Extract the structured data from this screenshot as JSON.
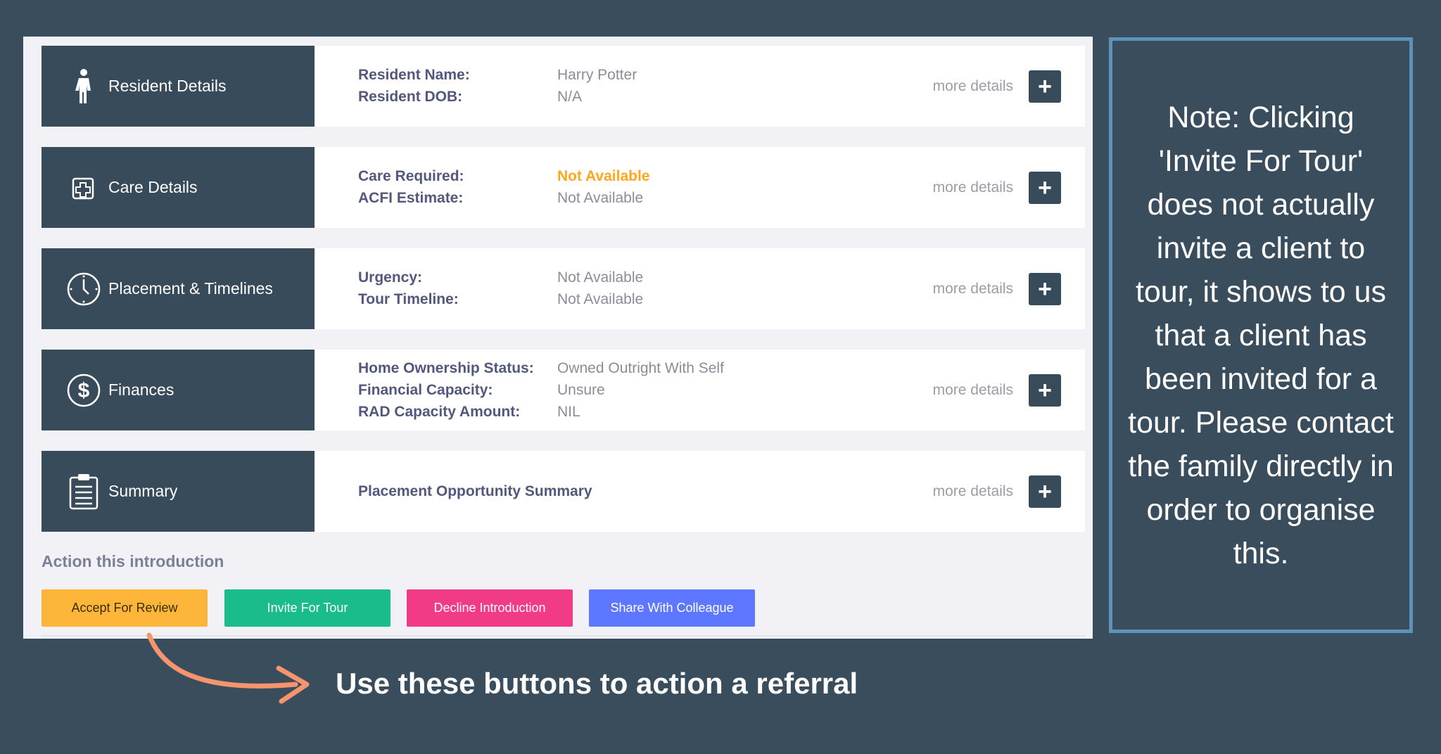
{
  "cards": [
    {
      "title": "Resident Details",
      "icon": "person-icon",
      "rows": [
        {
          "label": "Resident Name:",
          "value": "Harry Potter"
        },
        {
          "label": "Resident DOB:",
          "value": "N/A"
        }
      ],
      "more": "more details"
    },
    {
      "title": "Care Details",
      "icon": "medical-cross-icon",
      "rows": [
        {
          "label": "Care Required:",
          "value": "Not Available"
        },
        {
          "label": "ACFI Estimate:",
          "value": "Not Available"
        }
      ],
      "more": "more details"
    },
    {
      "title": "Placement & Timelines",
      "icon": "clock-icon",
      "rows": [
        {
          "label": "Urgency:",
          "value": "Not Available"
        },
        {
          "label": "Tour Timeline:",
          "value": "Not Available"
        }
      ],
      "more": "more details"
    },
    {
      "title": "Finances",
      "icon": "dollar-icon",
      "rows": [
        {
          "label": "Home Ownership Status:",
          "value": "Owned Outright With Self"
        },
        {
          "label": "Financial Capacity:",
          "value": "Unsure"
        },
        {
          "label": "RAD Capacity Amount:",
          "value": "NIL"
        }
      ],
      "more": "more details"
    },
    {
      "title": "Summary",
      "icon": "clipboard-icon",
      "summary_label": "Placement Opportunity Summary",
      "more": "more details"
    }
  ],
  "actions": {
    "heading": "Action this introduction",
    "accept": "Accept For Review",
    "invite": "Invite For Tour",
    "decline": "Decline Introduction",
    "share": "Share With Colleague"
  },
  "note": "Note: Clicking 'Invite For Tour' does not actually invite a client to tour, it shows to us that a client has been invited for a tour. Please contact the family directly in order to organise this.",
  "caption": "Use these buttons to action a referral",
  "colors": {
    "background": "#394d5c",
    "card_header": "#384b5b",
    "warn": "#fea61e",
    "accept": "#fdb63a",
    "invite": "#1abc8c",
    "decline": "#f13b86",
    "share": "#5e77ff",
    "arrow": "#f6956d",
    "callout_border": "#5e92b8"
  }
}
